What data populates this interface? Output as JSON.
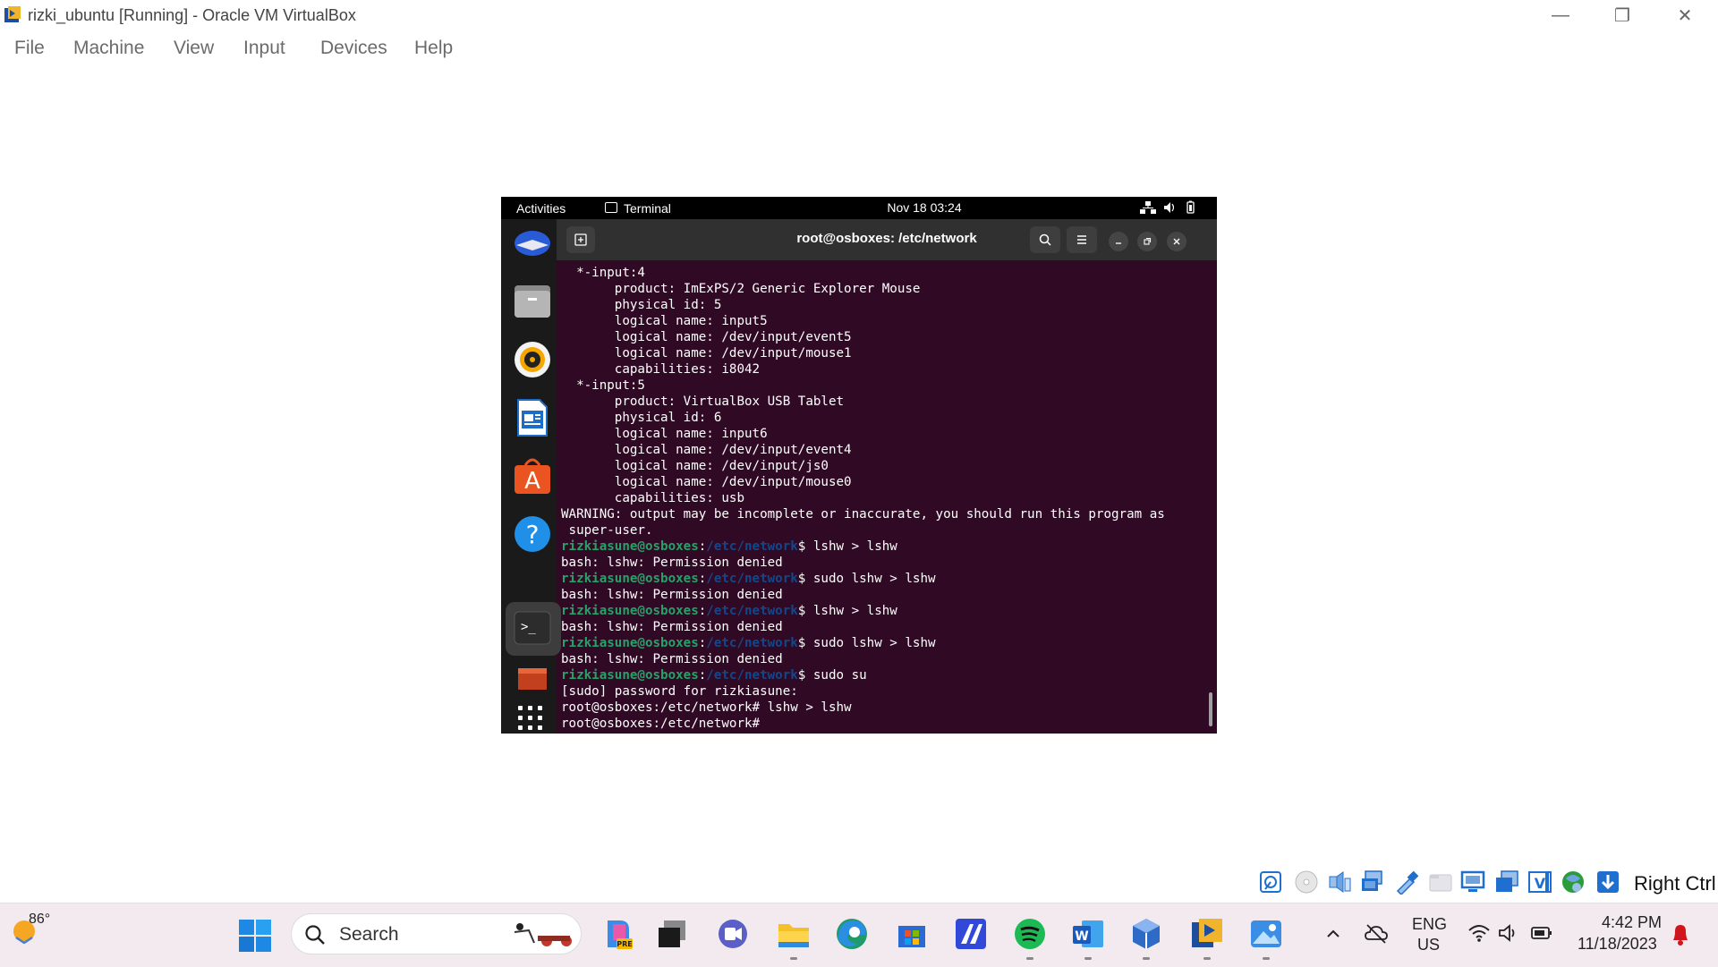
{
  "window": {
    "title": "rizki_ubuntu [Running] - Oracle VM VirtualBox",
    "minimize_glyph": "—",
    "restore_glyph": "❐",
    "close_glyph": "✕"
  },
  "menu": [
    "File",
    "Machine",
    "View",
    "Input",
    "Devices",
    "Help"
  ],
  "guest": {
    "topbar": {
      "activities": "Activities",
      "app": "Terminal",
      "clock": "Nov 18  03:24",
      "status_icons": [
        "network-icon",
        "volume-icon",
        "battery-icon"
      ]
    },
    "dock": [
      "thunderbird-icon",
      "files-icon",
      "rhythmbox-icon",
      "libreoffice-writer-icon",
      "app-center-icon",
      "help-icon",
      "terminal-icon",
      "trash-icon",
      "show-apps-icon"
    ],
    "terminal": {
      "title": "root@osboxes: /etc/network",
      "lines": [
        {
          "text": "  *-input:4"
        },
        {
          "text": "       product: ImExPS/2 Generic Explorer Mouse"
        },
        {
          "text": "       physical id: 5"
        },
        {
          "text": "       logical name: input5"
        },
        {
          "text": "       logical name: /dev/input/event5"
        },
        {
          "text": "       logical name: /dev/input/mouse1"
        },
        {
          "text": "       capabilities: i8042"
        },
        {
          "text": "  *-input:5"
        },
        {
          "text": "       product: VirtualBox USB Tablet"
        },
        {
          "text": "       physical id: 6"
        },
        {
          "text": "       logical name: input6"
        },
        {
          "text": "       logical name: /dev/input/event4"
        },
        {
          "text": "       logical name: /dev/input/js0"
        },
        {
          "text": "       logical name: /dev/input/mouse0"
        },
        {
          "text": "       capabilities: usb"
        },
        {
          "text": "WARNING: output may be incomplete or inaccurate, you should run this program as"
        },
        {
          "text": " super-user."
        },
        {
          "user": "rizkiasune@osboxes",
          "path": "/etc/network",
          "cmd": "$ lshw > lshw"
        },
        {
          "text": "bash: lshw: Permission denied"
        },
        {
          "user": "rizkiasune@osboxes",
          "path": "/etc/network",
          "cmd": "$ sudo lshw > lshw"
        },
        {
          "text": "bash: lshw: Permission denied"
        },
        {
          "user": "rizkiasune@osboxes",
          "path": "/etc/network",
          "cmd": "$ lshw > lshw"
        },
        {
          "text": "bash: lshw: Permission denied"
        },
        {
          "user": "rizkiasune@osboxes",
          "path": "/etc/network",
          "cmd": "$ sudo lshw > lshw"
        },
        {
          "text": "bash: lshw: Permission denied"
        },
        {
          "user": "rizkiasune@osboxes",
          "path": "/etc/network",
          "cmd": "$ sudo su"
        },
        {
          "text": "[sudo] password for rizkiasune:"
        },
        {
          "text": "root@osboxes:/etc/network# lshw > lshw"
        },
        {
          "text": "root@osboxes:/etc/network#"
        }
      ]
    }
  },
  "vbox_status": {
    "icons": [
      "hard-disk-icon",
      "optical-drive-icon",
      "audio-icon",
      "network-adapter-icon",
      "usb-icon",
      "shared-folders-icon",
      "display-icon",
      "recording-icon",
      "capture-icon",
      "mouse-integration-icon",
      "keyboard-icon"
    ],
    "host_key": "Right Ctrl",
    "colors": {
      "blue": "#1f6fd0",
      "green": "#2a9d3a"
    }
  },
  "taskbar": {
    "weather_temp": "86°",
    "search_placeholder": "Search",
    "apps": [
      "copilot-icon",
      "virtual-desktop-icon",
      "teams-icon",
      "file-explorer-icon",
      "edge-icon",
      "store-icon",
      "tool-icon",
      "spotify-icon",
      "word-icon",
      "virtualbox-icon",
      "virtualbox-vm-icon",
      "photos-icon"
    ],
    "language": {
      "line1": "ENG",
      "line2": "US"
    },
    "time": "4:42 PM",
    "date": "11/18/2023"
  }
}
